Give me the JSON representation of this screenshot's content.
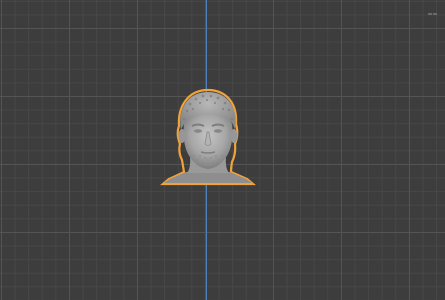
{
  "viewport": {
    "background": "#3d3d3d",
    "grid_major": "#545454",
    "grid_minor": "#484848",
    "axis_z_color": "#4f7fbf"
  },
  "object": {
    "name": "head-sculpt",
    "outline_color": "#f2a23a",
    "mesh_color": "#a9a9a9",
    "selected": true
  }
}
